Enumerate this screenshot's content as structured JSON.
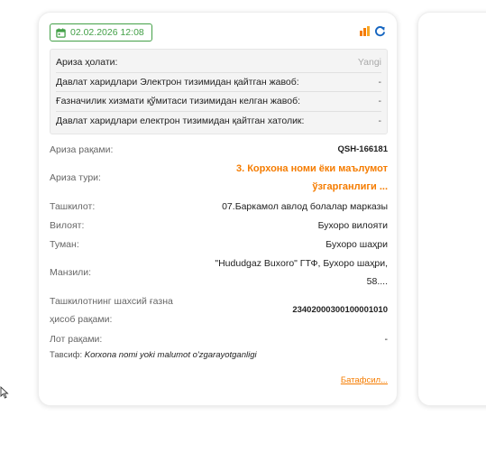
{
  "card": {
    "datetime": "02.02.2026 12:08",
    "status_rows": [
      {
        "label": "Ариза ҳолати:",
        "value": "Yangi"
      },
      {
        "label": "Давлат харидлари Электрон тизимидан қайтган жавоб:",
        "value": "-"
      },
      {
        "label": "Ғазначилик хизмати қўмитаси тизимидан келган жавоб:",
        "value": "-"
      },
      {
        "label": "Давлат харидлари електрон тизимидан қайтган хатолик:",
        "value": "-"
      }
    ],
    "application_number_label": "Ариза рақами:",
    "application_number": "QSH-166181",
    "application_type_label": "Ариза тури:",
    "application_type_line1": "3. Корхона номи ёки маълумот",
    "application_type_line2": "ўзгарганлиги ...",
    "organization_label": "Ташкилот:",
    "organization": "07.Баркамол авлод болалар марказы",
    "region_label": "Вилоят:",
    "region": "Бухоро вилояти",
    "district_label": "Туман:",
    "district": "Бухоро шаҳри",
    "address_label": "Манзили:",
    "address_line1": "\"Hududgaz Buxoro\" ГТФ, Бухоро шаҳри,",
    "address_line2": "58....",
    "account_label_line1": "Ташкилотнинг шахсий ғазна",
    "account_label_line2": "ҳисоб рақами:",
    "account_number": "23402000300100001010",
    "lot_label": "Лот рақами:",
    "lot_value": "-",
    "description_label": "Тавсиф:",
    "description": "Korxona nomi yoki malumot o'zgarayotganligi",
    "more_link": "Батафсил..."
  }
}
